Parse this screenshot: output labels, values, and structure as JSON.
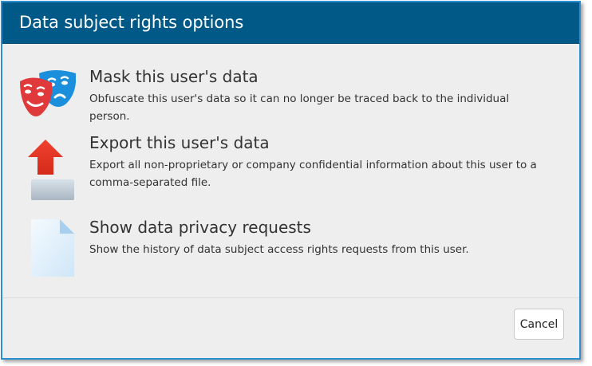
{
  "dialog": {
    "title": "Data subject rights options"
  },
  "options": [
    {
      "id": "mask",
      "icon": "theater-masks-icon",
      "title": "Mask this user's data",
      "description": "Obfuscate this user's data so it can no longer be traced back to the individual person."
    },
    {
      "id": "export",
      "icon": "export-upload-icon",
      "title": "Export this user's data",
      "description": "Export all non-proprietary or company confidential information about this user to a comma-separated file."
    },
    {
      "id": "requests",
      "icon": "document-icon",
      "title": "Show data privacy requests",
      "description": "Show the history of data subject access rights requests from this user."
    }
  ],
  "footer": {
    "cancel_label": "Cancel"
  },
  "colors": {
    "titlebar": "#005987",
    "dialog_border": "#2b8fd1",
    "background": "#eeeeee"
  }
}
